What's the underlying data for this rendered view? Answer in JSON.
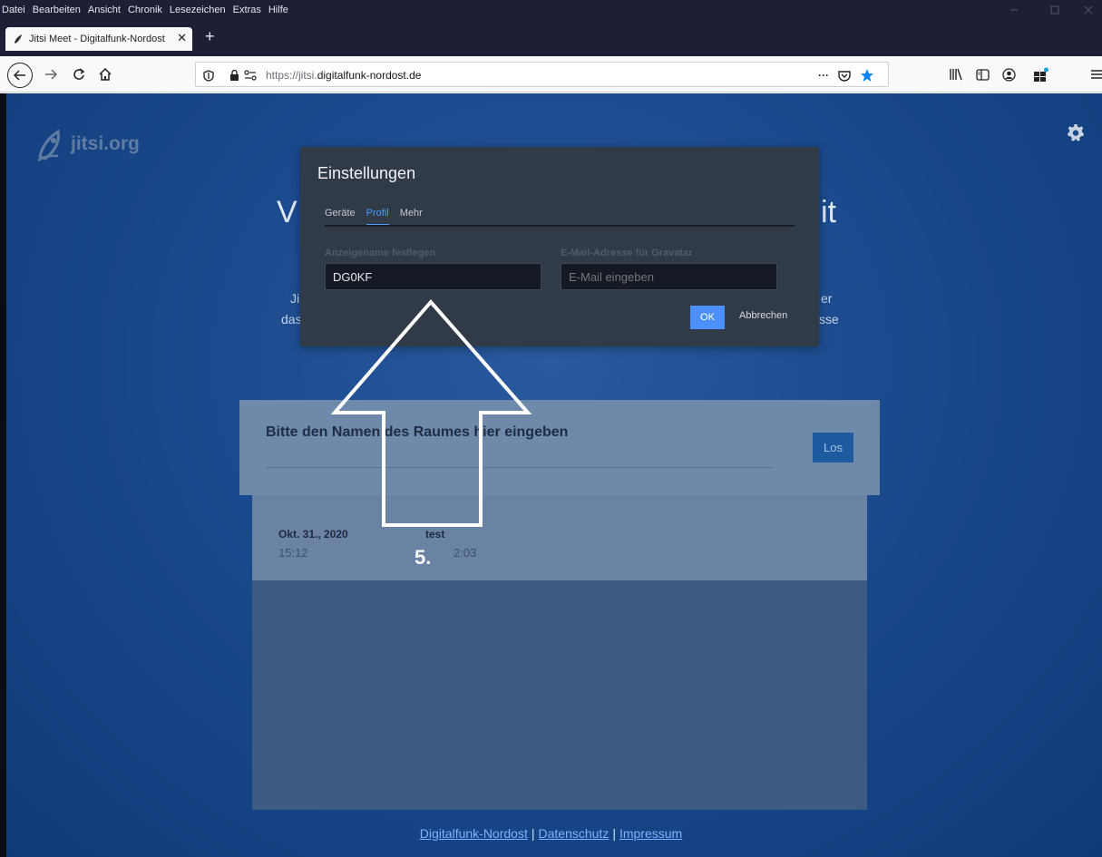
{
  "menubar": {
    "items": [
      "Datei",
      "Bearbeiten",
      "Ansicht",
      "Chronik",
      "Lesezeichen",
      "Extras",
      "Hilfe"
    ]
  },
  "tab": {
    "title": "Jitsi Meet - Digitalfunk-Nordost",
    "close": "✕"
  },
  "newtab": {
    "label": "+"
  },
  "urlbar": {
    "prefix": "https://jitsi.",
    "domain": "digitalfunk-nordost.de",
    "more": "···"
  },
  "page": {
    "logo": "jitsi.org",
    "hero_left": "V",
    "hero_right": "it",
    "line1_left": "Ji",
    "line1_right": "er",
    "line2_left": "das",
    "line2_right": "sse",
    "enter_label": "Bitte den Namen des Raumes hier eingeben",
    "go_button": "Los",
    "recent": [
      {
        "date": "Okt. 31., 2020",
        "time": "15:12",
        "name": "test",
        "duration": "2:03"
      }
    ],
    "footer": {
      "link1": "Digitalfunk-Nordost",
      "sep": "|",
      "link2": "Datenschutz",
      "link3": "Impressum"
    }
  },
  "dialog": {
    "title": "Einstellungen",
    "tabs": [
      {
        "label": "Geräte",
        "active": false
      },
      {
        "label": "Profil",
        "active": true
      },
      {
        "label": "Mehr",
        "active": false
      }
    ],
    "display_name_label": "Anzeigename festlegen",
    "display_name_value": "DG0KF",
    "email_label": "E-Mail-Adresse für Gravatar",
    "email_placeholder": "E-Mail eingeben",
    "ok": "OK",
    "cancel": "Abbrechen"
  },
  "annotation": {
    "step": "5."
  },
  "colors": {
    "accent": "#4c8fff",
    "page_blue": "#1a4a8d",
    "dialog_bg": "#313a47"
  }
}
